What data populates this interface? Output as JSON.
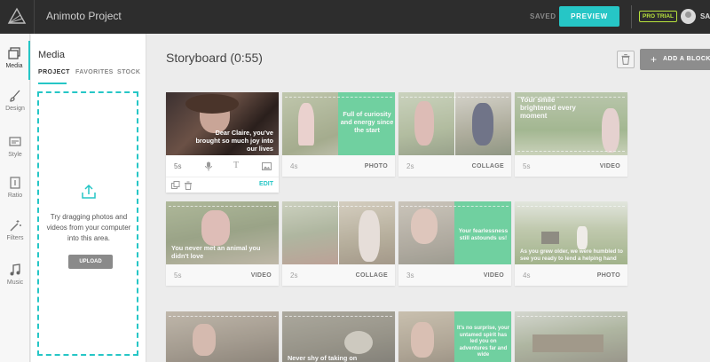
{
  "header": {
    "app_title": "Animoto Project",
    "saved_label": "SAVED",
    "preview_label": "PREVIEW",
    "trial_badge": "PRO TRIAL",
    "user_name": "SA"
  },
  "rail": {
    "items": [
      {
        "label": "Media",
        "icon": "photo-icon"
      },
      {
        "label": "Design",
        "icon": "brush-icon"
      },
      {
        "label": "Style",
        "icon": "style-icon"
      },
      {
        "label": "Ratio",
        "icon": "ratio-icon"
      },
      {
        "label": "Filters",
        "icon": "wand-icon"
      },
      {
        "label": "Music",
        "icon": "music-note-icon"
      }
    ]
  },
  "panel": {
    "title": "Media",
    "tabs": [
      "PROJECT",
      "FAVORITES",
      "STOCK"
    ],
    "drop_text": "Try dragging photos and videos from your computer into this area.",
    "upload_label": "UPLOAD"
  },
  "storyboard": {
    "title": "Storyboard (0:55)",
    "add_block_label": "ADD A BLOCK",
    "edit_label": "EDIT",
    "blocks": [
      {
        "duration": "5s",
        "type": "",
        "caption": "Dear Claire, you've brought so much joy into our lives"
      },
      {
        "duration": "4s",
        "type": "PHOTO",
        "caption": "Full of curiosity and energy since the start"
      },
      {
        "duration": "2s",
        "type": "COLLAGE",
        "caption": ""
      },
      {
        "duration": "5s",
        "type": "VIDEO",
        "caption": "Your smile brightened every moment"
      },
      {
        "duration": "5s",
        "type": "VIDEO",
        "caption": "You never met an animal you didn't love"
      },
      {
        "duration": "2s",
        "type": "COLLAGE",
        "caption": ""
      },
      {
        "duration": "3s",
        "type": "VIDEO",
        "caption": "Your fearlessness still astounds us!"
      },
      {
        "duration": "4s",
        "type": "PHOTO",
        "caption": "As you grew older, we were humbled to see you ready to lend a helping hand"
      },
      {
        "duration": "",
        "type": "",
        "caption": ""
      },
      {
        "duration": "",
        "type": "",
        "caption": "Never shy of taking on"
      },
      {
        "duration": "",
        "type": "",
        "caption": "It's no surprise, your untamed spirit has led you on adventures far and wide"
      },
      {
        "duration": "",
        "type": "",
        "caption": ""
      }
    ]
  }
}
